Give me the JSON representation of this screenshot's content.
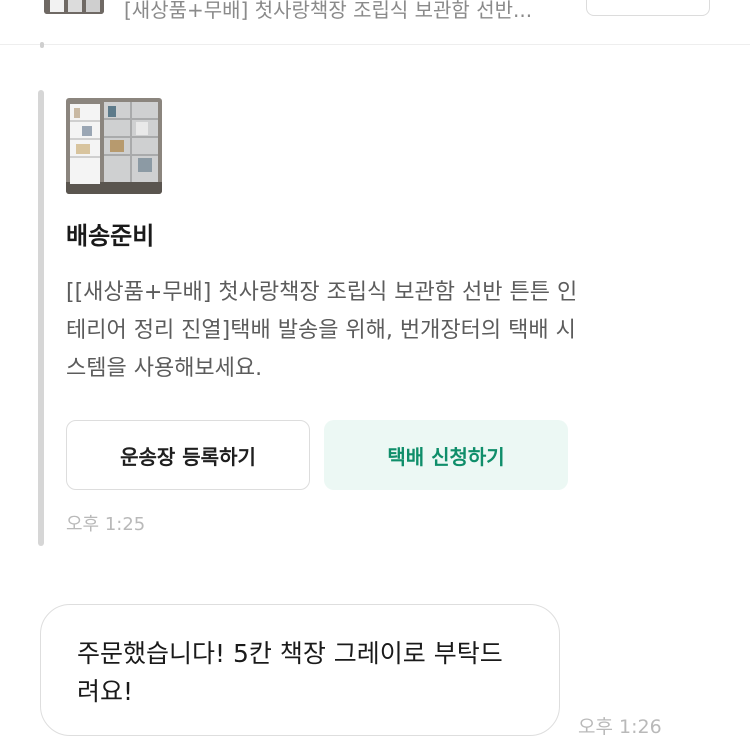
{
  "top_bar": {
    "product_title": "[새상품+무배] 첫사랑책장 조립식 보관함 선반..."
  },
  "status_message": {
    "title": "배송준비",
    "description": "[[새상품+무배] 첫사랑책장 조립식 보관함 선반 튼튼 인테리어 정리 진열]택배 발송을 위해, 번개장터의 택배 시스템을 사용해보세요.",
    "buttons": {
      "register_label": "운송장 등록하기",
      "request_label": "택배 신청하기"
    },
    "time": "오후 1:25"
  },
  "chat": {
    "message": "주문했습니다! 5칸 책장 그레이로 부탁드려요!",
    "time": "오후 1:26"
  },
  "colors": {
    "accent_green": "#0f8e6a",
    "accent_green_bg": "#ecf8f4",
    "muted_text": "#b9b9b9"
  }
}
